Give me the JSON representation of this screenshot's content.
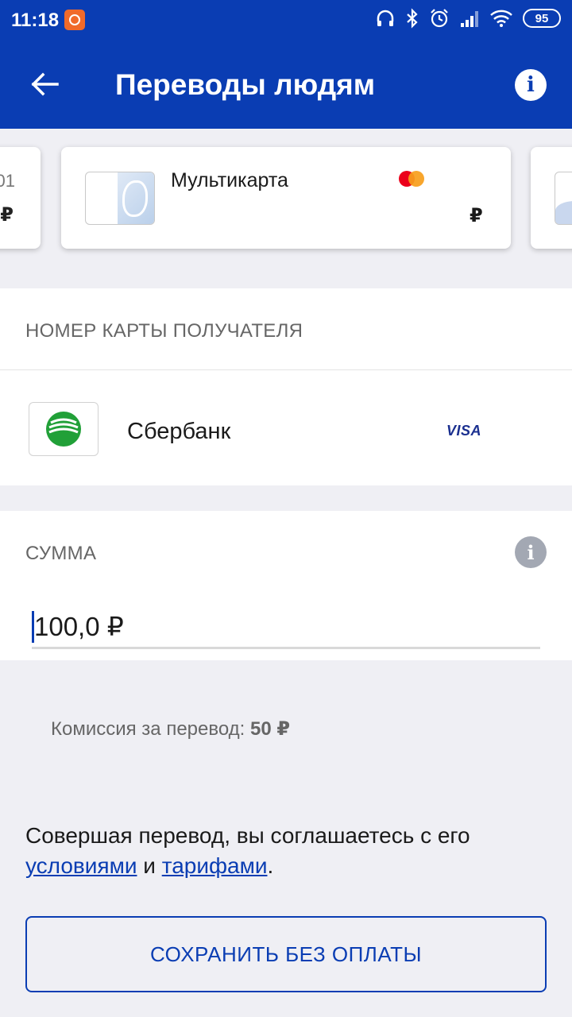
{
  "status_bar": {
    "time": "11:18",
    "battery": "95",
    "icons": [
      "app-notification-icon",
      "headphones-icon",
      "bluetooth-icon",
      "alarm-icon",
      "signal-icon",
      "wifi-icon",
      "battery-icon"
    ]
  },
  "app_bar": {
    "title": "Переводы людям",
    "back_icon": "arrow-left-icon",
    "info_icon": "info-icon"
  },
  "source_cards": {
    "previous_card": {
      "fragment_top": "01",
      "fragment_bottom": "₽"
    },
    "selected_card": {
      "name": "Мультикарта",
      "payment_system": "mastercard",
      "currency": "₽"
    }
  },
  "recipient": {
    "label": "НОМЕР КАРТЫ ПОЛУЧАТЕЛЯ",
    "bank_name": "Сбербанк",
    "payment_system": "VISA"
  },
  "amount": {
    "label": "СУММА",
    "value": "100,0 ₽"
  },
  "commission": {
    "label": "Комиссия за перевод:",
    "value": "50 ₽"
  },
  "terms": {
    "text_before": "Совершая перевод, вы соглашаетесь с его ",
    "link_conditions": "условиями",
    "conjunction": " и ",
    "link_tariffs": "тарифами",
    "text_after": "."
  },
  "actions": {
    "save_label": "СОХРАНИТЬ БЕЗ ОПЛАТЫ"
  },
  "colors": {
    "primary": "#0a3db3",
    "background": "#efeff4",
    "sberbank_green": "#21a038"
  }
}
